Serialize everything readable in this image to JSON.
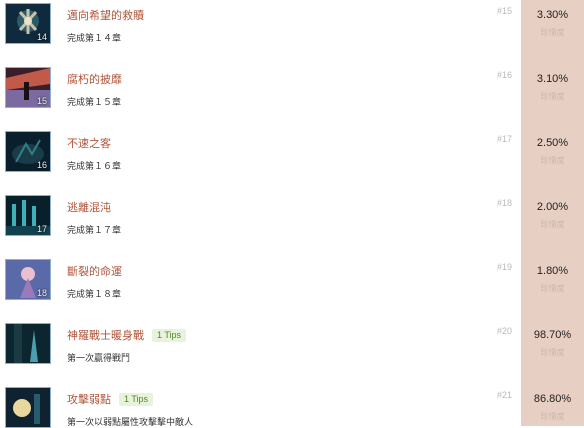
{
  "achievements": [
    {
      "title": "邁向希望的救贖",
      "tips": "",
      "desc": "完成第１４章",
      "index": "#15",
      "percent": "3.30%",
      "sub": "珍惜度",
      "thumb_num": "14",
      "colors": [
        "#0f2a3c",
        "#c8c2a8",
        "#2b5a6b"
      ]
    },
    {
      "title": "腐朽的披靡",
      "tips": "",
      "desc": "完成第１５章",
      "index": "#16",
      "percent": "3.10%",
      "sub": "珍惜度",
      "thumb_num": "15",
      "colors": [
        "#3a1f2a",
        "#c25a4a",
        "#7a6aa0"
      ]
    },
    {
      "title": "不速之客",
      "tips": "",
      "desc": "完成第１６章",
      "index": "#17",
      "percent": "2.50%",
      "sub": "珍惜度",
      "thumb_num": "16",
      "colors": [
        "#0a1f2c",
        "#2f7f8a",
        "#1a3b48"
      ]
    },
    {
      "title": "逃離混沌",
      "tips": "",
      "desc": "完成第１７章",
      "index": "#18",
      "percent": "2.00%",
      "sub": "珍惜度",
      "thumb_num": "17",
      "colors": [
        "#07202a",
        "#3fb0b8",
        "#12414d"
      ]
    },
    {
      "title": "斷裂的命運",
      "tips": "",
      "desc": "完成第１８章",
      "index": "#19",
      "percent": "1.80%",
      "sub": "珍惜度",
      "thumb_num": "18",
      "colors": [
        "#5a6aa8",
        "#e8c0d0",
        "#9a7ab8"
      ]
    },
    {
      "title": "神羅戰士暖身戰",
      "tips": "1 Tips",
      "desc": "第一次贏得戰鬥",
      "index": "#20",
      "percent": "98.70%",
      "sub": "珍惜度",
      "thumb_num": "",
      "colors": [
        "#0c2630",
        "#4aa0b0",
        "#1a3a44"
      ]
    },
    {
      "title": "攻擊弱點",
      "tips": "1 Tips",
      "desc": "第一次以弱點屬性攻擊擊中敵人",
      "index": "#21",
      "percent": "86.80%",
      "sub": "珍惜度",
      "thumb_num": "",
      "colors": [
        "#0e2230",
        "#e8d8a0",
        "#2a5a70"
      ]
    }
  ]
}
